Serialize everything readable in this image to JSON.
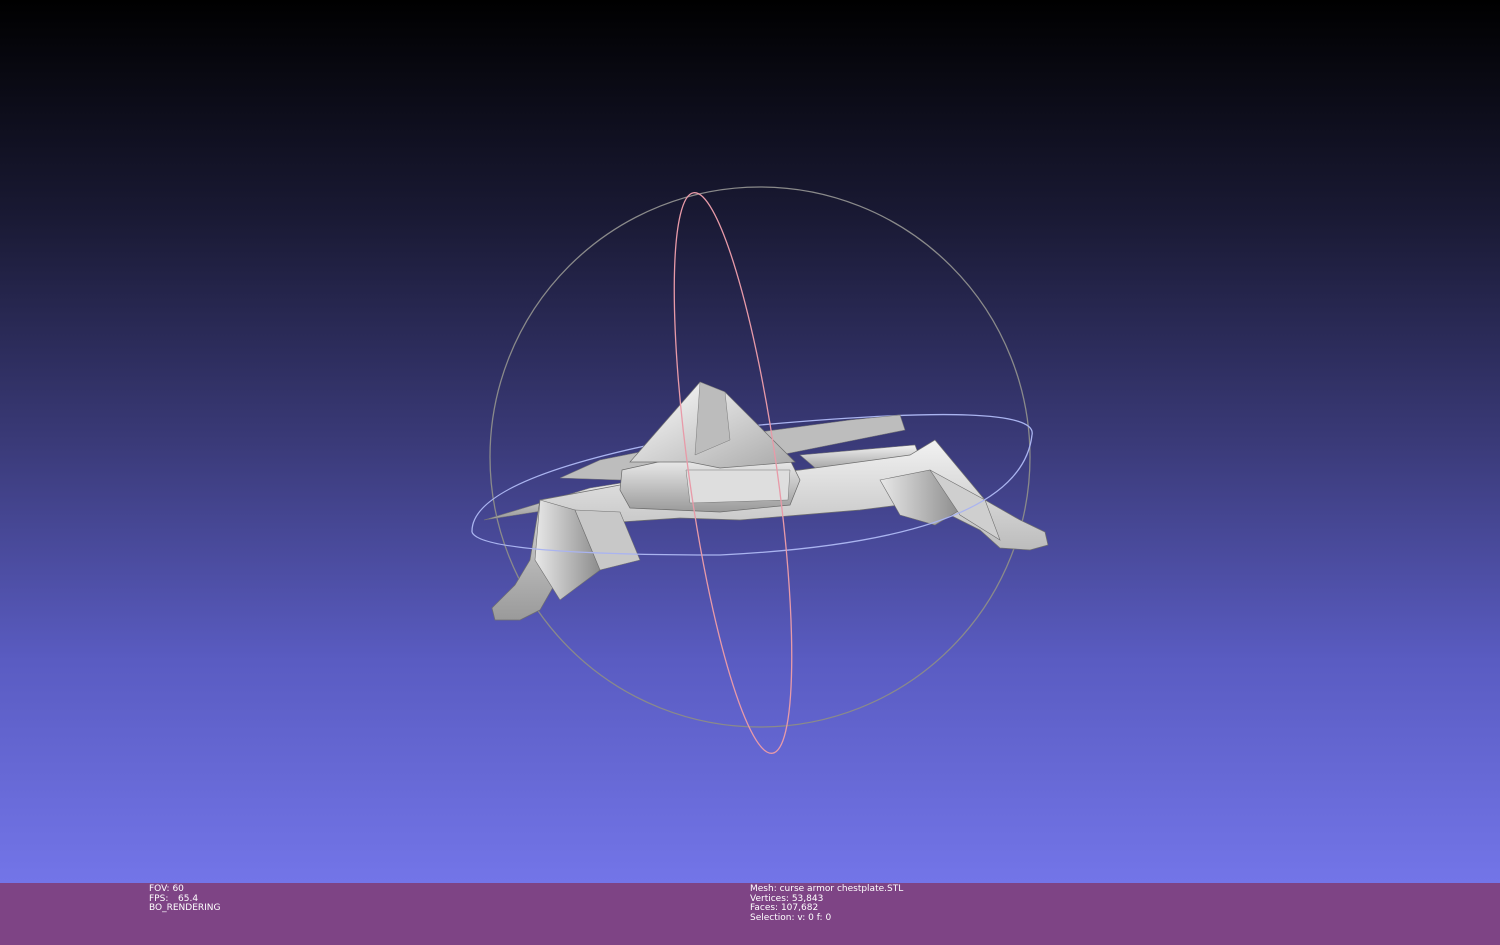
{
  "viewport": {
    "background_top": "#000000",
    "background_bottom": "#7375e8",
    "model_color": "#d6d6d6",
    "trackball": {
      "circle_color": "#8a8a8a",
      "vertical_ring_color": "#e89aa8",
      "horizontal_ring_color": "#aab4f0"
    }
  },
  "status": {
    "background": "#7e4485",
    "fov_label": "FOV:",
    "fov_value": "60",
    "fps_label": "FPS:",
    "fps_value": "65.4",
    "render_mode": "BO_RENDERING",
    "mesh_label": "Mesh:",
    "mesh_name": "curse armor chestplate.STL",
    "vertices_label": "Vertices:",
    "vertices_value": "53,843",
    "faces_label": "Faces:",
    "faces_value": "107,682",
    "selection_label": "Selection:",
    "selection_value": "v: 0 f: 0"
  }
}
